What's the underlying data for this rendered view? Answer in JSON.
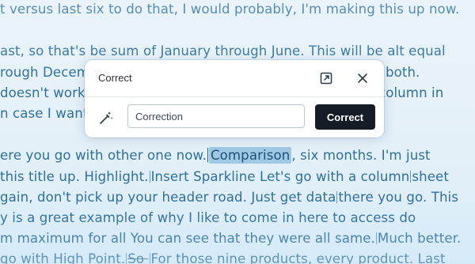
{
  "document": {
    "lines": [
      {
        "segments": [
          {
            "t": "t versus last six to do that, I would probably, I'm making this up now."
          }
        ]
      },
      {
        "segments": [
          {
            "t": "ast, so that's be sum of January through June. This will be alt equal"
          }
        ]
      },
      {
        "segments": [
          {
            "t": "rough Decem"
          },
          {
            "t": "em both.",
            "gap": true
          }
        ]
      },
      {
        "segments": [
          {
            "t": " doesn't work"
          },
          {
            "t": "column in",
            "gap": true
          }
        ]
      },
      {
        "segments": [
          {
            "t": "n case I want"
          }
        ]
      },
      {
        "segments": [
          {
            "t": "ere you go with other one now."
          },
          {
            "caret": true
          },
          {
            "t": "Comparison",
            "sel": true
          },
          {
            "t": ", six months. I'm just"
          }
        ]
      },
      {
        "segments": [
          {
            "t": " this title up. Highlight."
          },
          {
            "tick": true
          },
          {
            "t": "Insert Sparkline Let's go with a column"
          },
          {
            "tick": true
          },
          {
            "t": "sheet"
          }
        ]
      },
      {
        "segments": [
          {
            "t": "gain, don't pick up your header road. Just get data"
          },
          {
            "tick": true
          },
          {
            "t": "there you go. This"
          }
        ]
      },
      {
        "segments": [
          {
            "t": "y is a great example of why I like to come in here to access do"
          }
        ]
      },
      {
        "segments": [
          {
            "t": "m maximum for all You can see that they were all same."
          },
          {
            "tick": true
          },
          {
            "t": "Much better."
          }
        ]
      },
      {
        "segments": [
          {
            "t": " go with High Point."
          },
          {
            "tick": true
          },
          {
            "t": "So ",
            "strike": true
          },
          {
            "tick": true
          },
          {
            "t": "For those nine products, every product. Last"
          }
        ]
      }
    ]
  },
  "dialog": {
    "title": "Correct",
    "open_icon": "open-external-icon",
    "close_icon": "close-icon",
    "wand_icon": "magic-wand-icon",
    "input_value": "Correction",
    "input_placeholder": "Correction",
    "button_label": "Correct"
  },
  "colors": {
    "text": "#2f6f9e",
    "selection": "#9fc9e3",
    "button_bg": "#151c25"
  }
}
